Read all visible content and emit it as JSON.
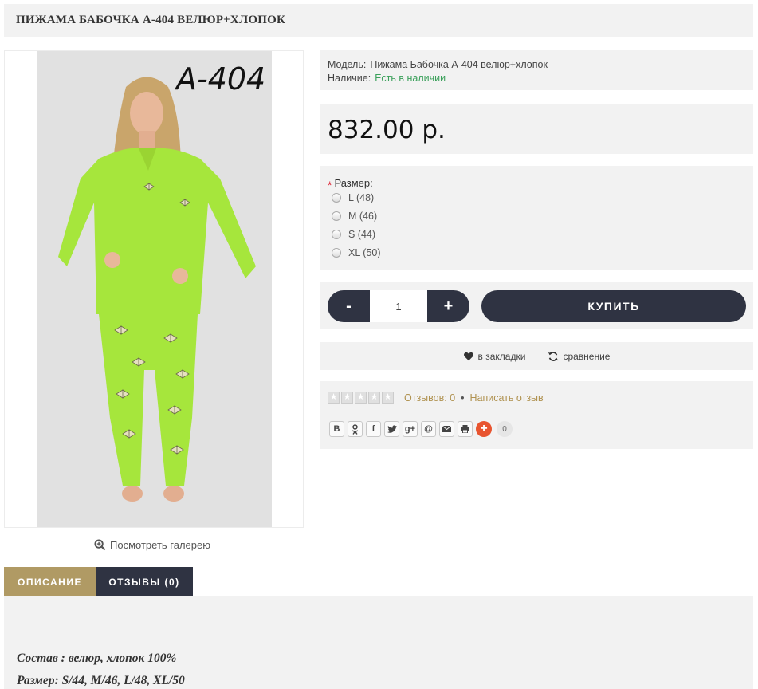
{
  "product": {
    "title": "ПИЖАМА БАБОЧКА А-404 ВЕЛЮР+ХЛОПОК",
    "image_label": "A-404",
    "gallery_link": "Посмотреть галерею"
  },
  "meta": {
    "model_label": "Модель:",
    "model_value": "Пижама Бабочка А-404 велюр+хлопок",
    "stock_label": "Наличие:",
    "stock_value": "Есть в наличии"
  },
  "price": "832.00 р.",
  "options": {
    "required_mark": "*",
    "title": "Размер:",
    "sizes": [
      "L (48)",
      "M (46)",
      "S (44)",
      "XL (50)"
    ]
  },
  "cart": {
    "minus": "-",
    "quantity": "1",
    "plus": "+",
    "buy_label": "КУПИТЬ"
  },
  "actions": {
    "wishlist": "в закладки",
    "compare": "сравнение"
  },
  "reviews": {
    "count_label": "Отзывов: 0",
    "separator": "•",
    "write_label": "Написать отзыв",
    "share_count": "0"
  },
  "share_buttons": {
    "vk": "B",
    "ok": "ok-icon",
    "facebook": "f",
    "twitter": "twitter-icon",
    "gplus": "g+",
    "mail": "@",
    "email": "envelope-icon",
    "print": "printer-icon",
    "more": "+"
  },
  "tabs": {
    "description": "ОПИСАНИЕ",
    "reviews": "ОТЗЫВЫ (0)"
  },
  "description": {
    "line1": "Состав : велюр, хлопок 100%",
    "line2": "Размер: S/44, M/46, L/48, XL/50"
  },
  "colors": {
    "accent_gold": "#b09a64",
    "dark_navy": "#2f3342",
    "stock_green": "#3aa05a",
    "panel_bg": "#f2f2f2"
  }
}
